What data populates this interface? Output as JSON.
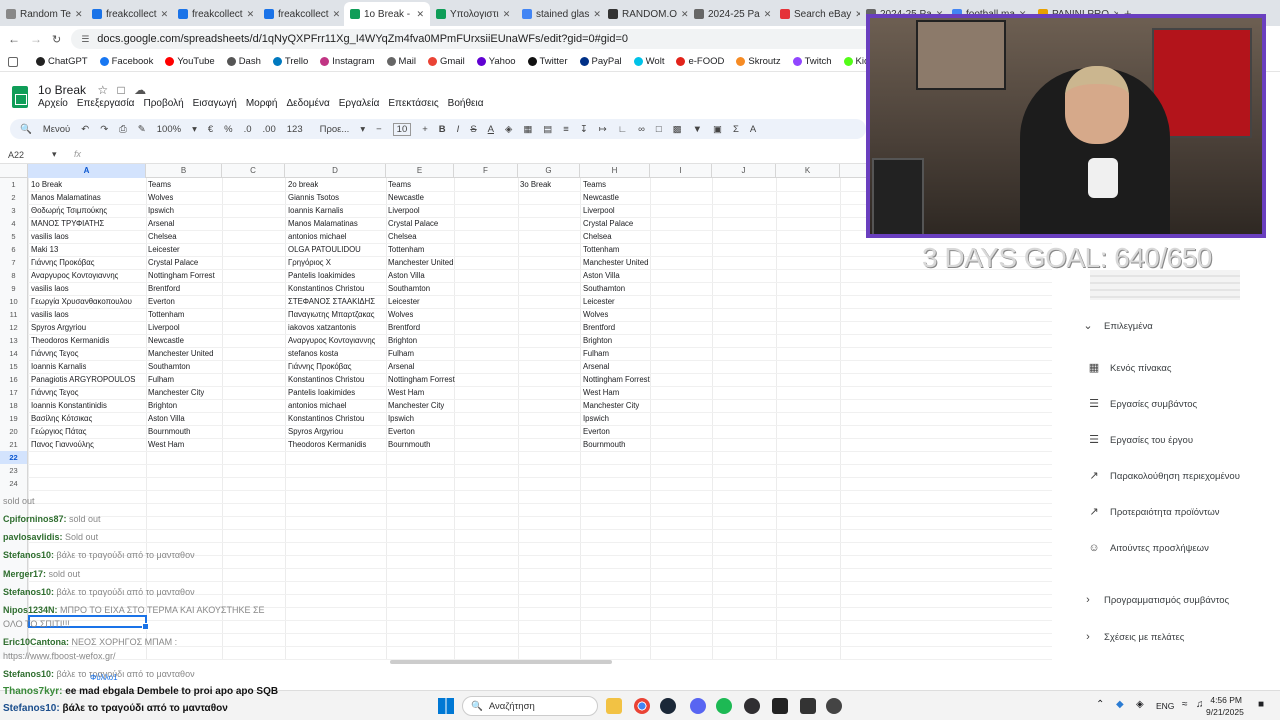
{
  "browser": {
    "tabs": [
      {
        "label": "Random Te",
        "color": "#888888"
      },
      {
        "label": "freakcollect",
        "color": "#1a73e8"
      },
      {
        "label": "freakcollect",
        "color": "#1a73e8"
      },
      {
        "label": "freakcollect",
        "color": "#1a73e8"
      },
      {
        "label": "1o Break - ",
        "color": "#0f9d58",
        "active": true
      },
      {
        "label": "Υπολογιστι",
        "color": "#0f9d58"
      },
      {
        "label": "stained glas",
        "color": "#4285f4"
      },
      {
        "label": "RANDOM.O",
        "color": "#333333"
      },
      {
        "label": "2024-25 Pa",
        "color": "#666666"
      },
      {
        "label": "Search eBay",
        "color": "#e53238"
      },
      {
        "label": "2024-25 Pa",
        "color": "#666666"
      },
      {
        "label": "football ma",
        "color": "#4285f4"
      },
      {
        "label": "PANINI PRO",
        "color": "#e8a000"
      }
    ],
    "url": "docs.google.com/spreadsheets/d/1qNyQXPFrr11Xg_I4WYqZm4fva0MPmFUrxsiiEUnaWFs/edit?gid=0#gid=0",
    "bookmarks": [
      {
        "label": "ChatGPT",
        "color": "#222222"
      },
      {
        "label": "Facebook",
        "color": "#1877f2"
      },
      {
        "label": "YouTube",
        "color": "#ff0000"
      },
      {
        "label": "Dash",
        "color": "#555555"
      },
      {
        "label": "Trello",
        "color": "#0079bf"
      },
      {
        "label": "Instagram",
        "color": "#c13584"
      },
      {
        "label": "Mail",
        "color": "#666666"
      },
      {
        "label": "Gmail",
        "color": "#ea4335"
      },
      {
        "label": "Yahoo",
        "color": "#6001d2"
      },
      {
        "label": "Twitter",
        "color": "#111111"
      },
      {
        "label": "PayPal",
        "color": "#003087"
      },
      {
        "label": "Wolt",
        "color": "#00c2e8"
      },
      {
        "label": "e-FOOD",
        "color": "#e2231a"
      },
      {
        "label": "Skroutz",
        "color": "#f68b24"
      },
      {
        "label": "Twitch",
        "color": "#9146ff"
      },
      {
        "label": "Kick",
        "color": "#53fc18"
      },
      {
        "label": "FutBin",
        "color": "#2b8a3e"
      },
      {
        "label": "Live",
        "color": "#cc0000"
      }
    ]
  },
  "doc": {
    "title": "1o Break",
    "menus": [
      "Αρχείο",
      "Επεξεργασία",
      "Προβολή",
      "Εισαγωγή",
      "Μορφή",
      "Δεδομένα",
      "Εργαλεία",
      "Επεκτάσεις",
      "Βοήθεια"
    ],
    "toolbar": {
      "menu_label": "Μενού",
      "zoom": "100%",
      "currency": "€",
      "percent": "%",
      "decimals_dec": ".0",
      "decimals_inc": ".00",
      "format_123": "123",
      "font": "Προε...",
      "font_size": "10"
    },
    "name_box": "A22"
  },
  "sheet": {
    "columns": [
      "A",
      "B",
      "C",
      "D",
      "E",
      "F",
      "G",
      "H",
      "I",
      "J",
      "K"
    ],
    "row_numbers": [
      "1",
      "2",
      "3",
      "4",
      "5",
      "6",
      "7",
      "8",
      "9",
      "10",
      "11",
      "12",
      "13",
      "14",
      "15",
      "16",
      "17",
      "18",
      "19",
      "20",
      "21",
      "22",
      "23",
      "24"
    ],
    "rows": [
      [
        "1o Break",
        "Teams",
        "2o break",
        "Teams",
        "3o Break",
        "Teams"
      ],
      [
        "Manos Malamatinas",
        "Wolves",
        "Giannis Tsotos",
        "Newcastle",
        "",
        "Newcastle"
      ],
      [
        "Θοδωρής Τσιμπούκης",
        "Ipswich",
        "Ioannis Karnalis",
        "Liverpool",
        "",
        "Liverpool"
      ],
      [
        "ΜΑΝΟΣ ΤΡΥΦΙΑΤΗΣ",
        "Arsenal",
        "Manos Malamatinas",
        "Crystal Palace",
        "",
        "Crystal Palace"
      ],
      [
        "vasilis laos",
        "Chelsea",
        "antonios michael",
        "Chelsea",
        "",
        "Chelsea"
      ],
      [
        "Maki 13",
        "Leicester",
        "OLGA PATOULIDOU",
        "Tottenham",
        "",
        "Tottenham"
      ],
      [
        "Γιάννης Προκόβας",
        "Crystal Palace",
        "Γρηγόριος Χ",
        "Manchester United",
        "",
        "Manchester United"
      ],
      [
        "Αναργυρος Κοντογιαννης",
        "Nottingham Forrest",
        "Pantelis Ioakimides",
        "Aston Villa",
        "",
        "Aston Villa"
      ],
      [
        "vasilis laos",
        "Brentford",
        "Konstantinos Christou",
        "Southamton",
        "",
        "Southamton"
      ],
      [
        "Γεωργία Χρυσανθακοπουλου",
        "Everton",
        "ΣΤΕΦΑΝΟΣ ΣΤΑΑΚΙΔΗΣ",
        "Leicester",
        "",
        "Leicester"
      ],
      [
        "vasilis laos",
        "Tottenham",
        "Παναγιωτης Μπαρτζακας",
        "Wolves",
        "",
        "Wolves"
      ],
      [
        "Spyros Argyriou",
        "Liverpool",
        "iakovos xatzantonis",
        "Brentford",
        "",
        "Brentford"
      ],
      [
        "Theodoros Kermanidis",
        "Newcastle",
        "Αναργυρος Κοντογιαννης",
        "Brighton",
        "",
        "Brighton"
      ],
      [
        "Γιάννης Τεγος",
        "Manchester United",
        "stefanos kosta",
        "Fulham",
        "",
        "Fulham"
      ],
      [
        "Ioannis Karnalis",
        "Southamton",
        "Γιάννης Προκόβας",
        "Arsenal",
        "",
        "Arsenal"
      ],
      [
        "Panagiotis ARGYROPOULOS",
        "Fulham",
        "Konstantinos Christou",
        "Nottingham Forrest",
        "",
        "Nottingham Forrest"
      ],
      [
        "Γιάννης Τεγος",
        "Manchester City",
        "Pantelis Ioakimides",
        "West Ham",
        "",
        "West Ham"
      ],
      [
        "Ioannis Konstantinidis",
        "Brighton",
        "antonios michael",
        "Manchester City",
        "",
        "Manchester City"
      ],
      [
        "Βασίλης Κότσικας",
        "Aston Villa",
        "Konstantinos Christou",
        "Ipswich",
        "",
        "Ipswich"
      ],
      [
        "Γεώργιος Πάτας",
        "Bournmouth",
        "Spyros Argyriou",
        "Everton",
        "",
        "Everton"
      ],
      [
        "Πανος Γιαννούλης",
        "West Ham",
        "Theodoros Kermanidis",
        "Bournmouth",
        "",
        "Bournmouth"
      ]
    ]
  },
  "overlay": {
    "goal_text": "3 DAYS GOAL: 640/650"
  },
  "side_panel": {
    "section_label": "Επιλεγμένα",
    "items": [
      {
        "label": "Κενός πίνακας",
        "icon": "table-icon"
      },
      {
        "label": "Εργασίες συμβάντος",
        "icon": "checklist-icon"
      },
      {
        "label": "Εργασίες του έργου",
        "icon": "checklist-icon"
      },
      {
        "label": "Παρακολούθηση περιεχομένου",
        "icon": "trend-icon"
      },
      {
        "label": "Προτεραιότητα προϊόντων",
        "icon": "trend-icon"
      },
      {
        "label": "Αιτούντες προσλήψεων",
        "icon": "person-icon"
      }
    ],
    "collapsed": [
      "Προγραμματισμός συμβάντος",
      "Σχέσεις με πελάτες"
    ]
  },
  "chat": {
    "lines": [
      {
        "user": "",
        "msg": "sold out"
      },
      {
        "user": "Cpiforninos87:",
        "msg": "sold out"
      },
      {
        "user": "pavlosavlidis:",
        "msg": "Sold out"
      },
      {
        "user": "Stefanos10:",
        "msg": "βάλε το τραγούδι από το μανταθον"
      },
      {
        "user": "Merger17:",
        "msg": "sold out"
      },
      {
        "user": "Stefanos10:",
        "msg": "βάλε το τραγούδι από το μανταθον"
      },
      {
        "user": "Nipos1234N:",
        "msg": "ΜΠΡΟ ΤΟ ΕΙΧΑ ΣΤΟ ΤΕΡΜΑ ΚΑΙ ΑΚΟΥΣΤΗΚΕ ΣΕ"
      },
      {
        "user": "",
        "msg": "ΟΛΟ ΤΟ ΣΠΙΤΙ!!!"
      },
      {
        "user": "Eric10Cantona:",
        "msg": "ΝΕΟΣ ΧΟΡΗΓΟΣ ΜΠΑΜ :"
      },
      {
        "user": "",
        "msg": "https://www.fboost-wefox.gr/"
      },
      {
        "user": "Stefanos10:",
        "msg": "βάλε το τραγούδι από το μανταθον"
      },
      {
        "user": "Thanos7kyr:",
        "msg": "ee mad ebgala Dembele to proi apo apo SQB"
      },
      {
        "user": "Stefanos10:",
        "msg": "βάλε το τραγούδι από το μανταθον"
      }
    ],
    "sheet_tab": "Φύλλο1"
  },
  "taskbar": {
    "search_placeholder": "Αναζήτηση",
    "lang": "ENG",
    "time": "4:56 PM",
    "date": "9/21/2025"
  }
}
